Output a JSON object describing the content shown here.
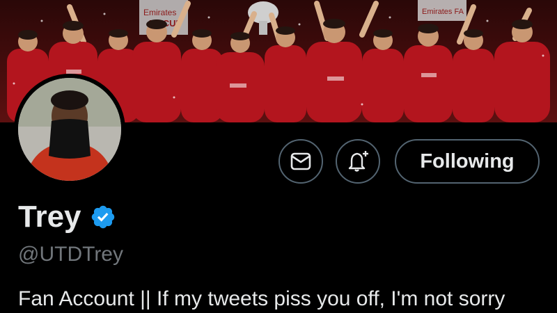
{
  "profile": {
    "display_name": "Trey",
    "handle": "@UTDTrey",
    "bio": "Fan Account || If my tweets piss you off, I'm not sorry",
    "verified": true
  },
  "actions": {
    "message_icon": "envelope-icon",
    "notify_icon": "bell-plus-icon",
    "follow_label": "Following"
  },
  "banner": {
    "alt": "team-celebration-photo",
    "texts": [
      "Emirates",
      "FA CUP",
      "Emirates FA"
    ]
  },
  "colors": {
    "background": "#000000",
    "primary_text": "#e7e9ea",
    "secondary_text": "#71767b",
    "border": "#536471",
    "verified_blue": "#1d9bf0",
    "banner_red": "#8b1a1a"
  }
}
